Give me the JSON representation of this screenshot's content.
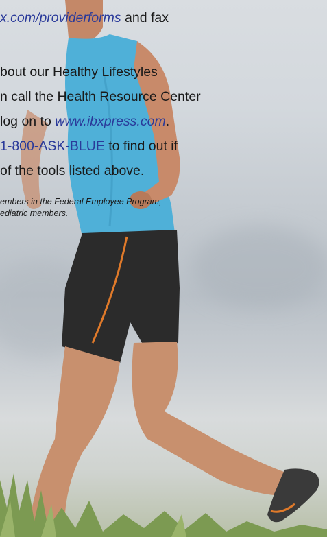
{
  "paragraph1": {
    "line1_link": "x.com/providerforms",
    "line1_rest": " and fax"
  },
  "paragraph2": {
    "line1": "bout our Healthy Lifestyles",
    "line2": "n call the Health Resource Center",
    "line3_pre": " log on to ",
    "line3_link": "www.ibxpress.com",
    "line3_post": ".",
    "line4_phone": "1-800-ASK-BLUE",
    "line4_rest": " to find out if",
    "line5": "of the tools listed above."
  },
  "footnote": {
    "line1": "embers in the Federal Employee Program,",
    "line2": "ediatric members."
  },
  "colors": {
    "link": "#2a3a9a",
    "shirt": "#4fb0d8",
    "shorts": "#2a2a2a",
    "stripe": "#e07a2a",
    "grass": "#7c9a52"
  }
}
